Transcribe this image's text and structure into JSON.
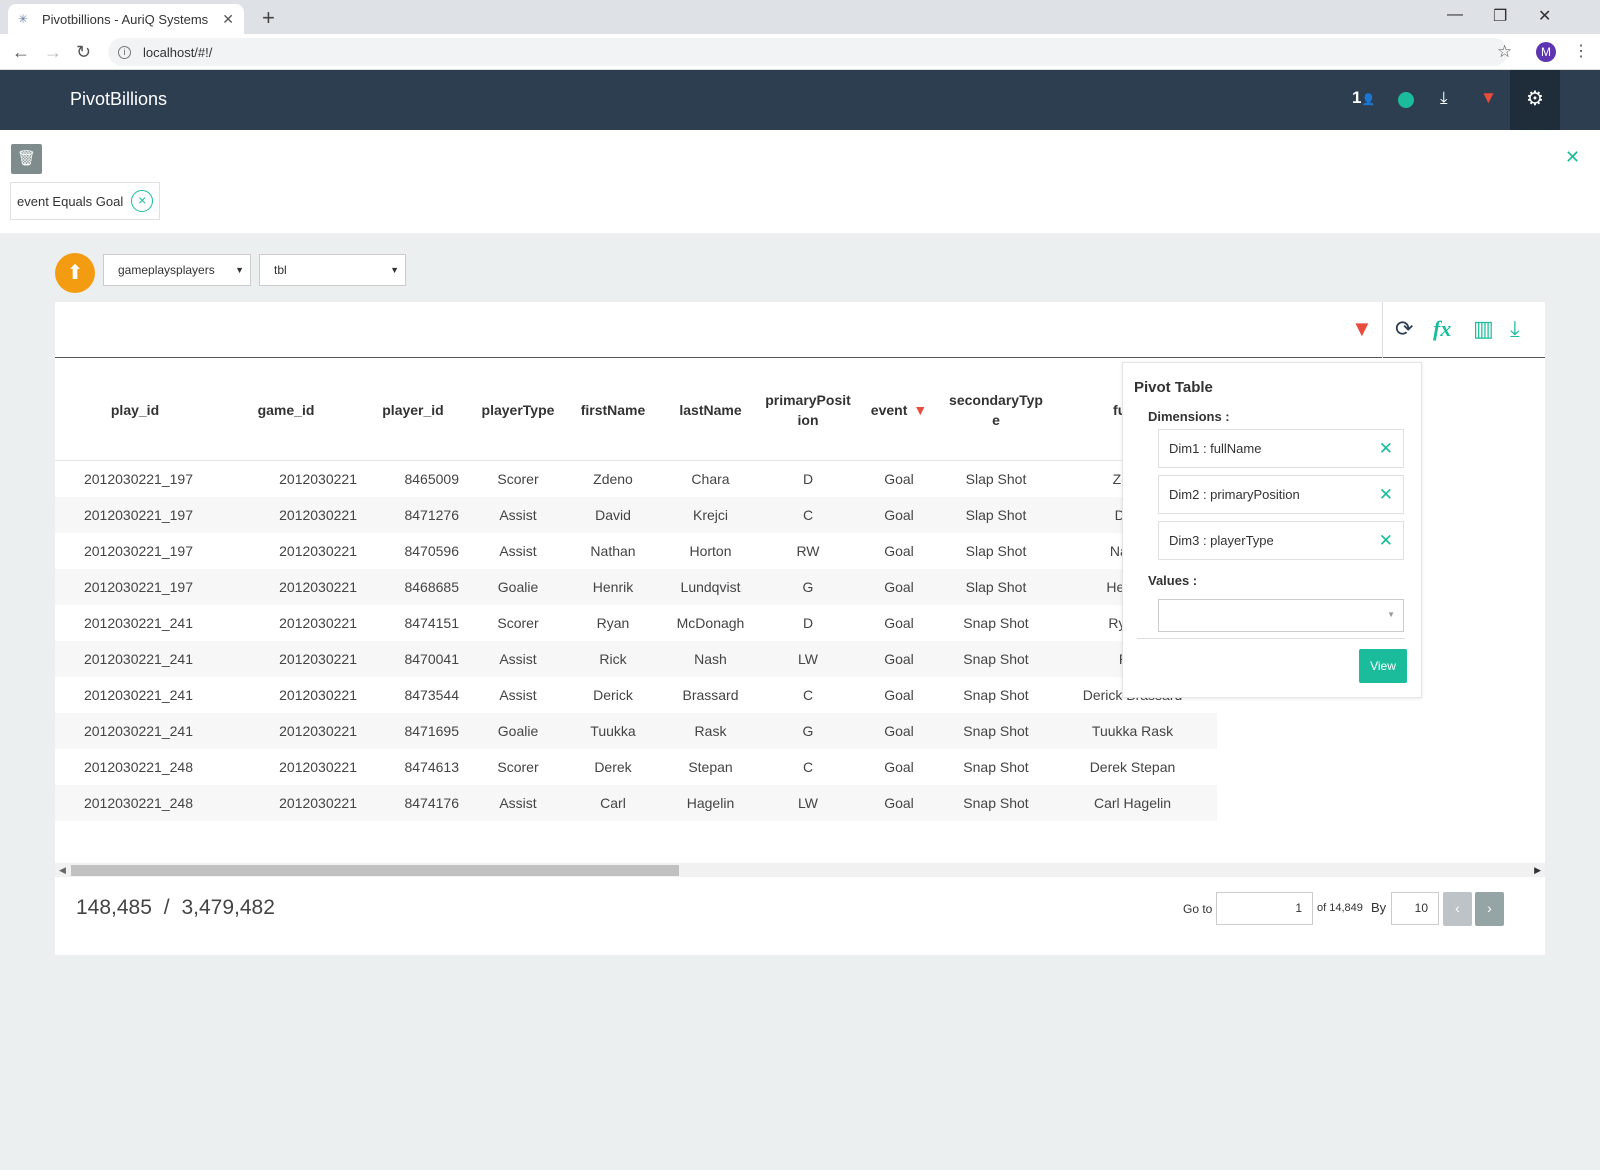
{
  "browser": {
    "tab_title": "Pivotbillions - AuriQ Systems",
    "url": "localhost/#!/",
    "profile_initial": "M"
  },
  "app": {
    "brand": "PivotBillions",
    "users_count": "1"
  },
  "filter_bar": {
    "chip_label": "event Equals Goal"
  },
  "controls": {
    "dataset_select": "gameplaysplayers",
    "table_select": "tbl"
  },
  "table": {
    "columns": [
      "play_id",
      "game_id",
      "player_id",
      "playerType",
      "firstName",
      "lastName",
      "primaryPosit\nion",
      "event",
      "secondaryTyp\ne",
      "fullNa"
    ],
    "rows": [
      [
        "2012030221_197",
        "2012030221",
        "8465009",
        "Scorer",
        "Zdeno",
        "Chara",
        "D",
        "Goal",
        "Slap Shot",
        "Zdeno"
      ],
      [
        "2012030221_197",
        "2012030221",
        "8471276",
        "Assist",
        "David",
        "Krejci",
        "C",
        "Goal",
        "Slap Shot",
        "David"
      ],
      [
        "2012030221_197",
        "2012030221",
        "8470596",
        "Assist",
        "Nathan",
        "Horton",
        "RW",
        "Goal",
        "Slap Shot",
        "Nathan"
      ],
      [
        "2012030221_197",
        "2012030221",
        "8468685",
        "Goalie",
        "Henrik",
        "Lundqvist",
        "G",
        "Goal",
        "Slap Shot",
        "Henrik L"
      ],
      [
        "2012030221_241",
        "2012030221",
        "8474151",
        "Scorer",
        "Ryan",
        "McDonagh",
        "D",
        "Goal",
        "Snap Shot",
        "Ryan M"
      ],
      [
        "2012030221_241",
        "2012030221",
        "8470041",
        "Assist",
        "Rick",
        "Nash",
        "LW",
        "Goal",
        "Snap Shot",
        "Rick"
      ],
      [
        "2012030221_241",
        "2012030221",
        "8473544",
        "Assist",
        "Derick",
        "Brassard",
        "C",
        "Goal",
        "Snap Shot",
        "Derick Brassard"
      ],
      [
        "2012030221_241",
        "2012030221",
        "8471695",
        "Goalie",
        "Tuukka",
        "Rask",
        "G",
        "Goal",
        "Snap Shot",
        "Tuukka Rask"
      ],
      [
        "2012030221_248",
        "2012030221",
        "8474613",
        "Scorer",
        "Derek",
        "Stepan",
        "C",
        "Goal",
        "Snap Shot",
        "Derek Stepan"
      ],
      [
        "2012030221_248",
        "2012030221",
        "8474176",
        "Assist",
        "Carl",
        "Hagelin",
        "LW",
        "Goal",
        "Snap Shot",
        "Carl Hagelin"
      ]
    ]
  },
  "footer": {
    "filtered_count": "148,485",
    "separator": "/",
    "total_count": "3,479,482",
    "goto_label": "Go to",
    "page_value": "1",
    "of_label": "of 14,849",
    "by_label": "By",
    "per_page": "10"
  },
  "pivot": {
    "title": "Pivot Table",
    "dimensions_label": "Dimensions :",
    "dimensions": [
      "Dim1 : fullName",
      "Dim2 : primaryPosition",
      "Dim3 : playerType"
    ],
    "values_label": "Values :",
    "view_button": "View"
  },
  "colors": {
    "header_bg": "#2c3e50",
    "accent": "#1abc9c",
    "filter_red": "#e74c3c",
    "upload_orange": "#f39c12"
  }
}
